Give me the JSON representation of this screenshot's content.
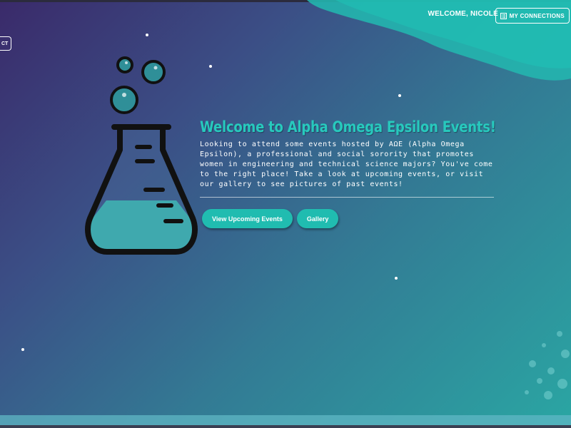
{
  "header": {
    "welcome_text": "WELCOME, NICOLE",
    "connections_label": "MY CONNECTIONS",
    "connections_icon": "list-icon"
  },
  "side_tab": {
    "label": "CT"
  },
  "hero": {
    "title": "Welcome to Alpha Omega Epsilon Events!",
    "description": "Looking to attend some events hosted by ΑΩΕ (Alpha Omega Epsilon), a professional and social sorority that promotes women in engineering and technical science majors? You've come to the right place! Take a look at upcoming events, or visit our gallery to see pictures of past events!",
    "buttons": {
      "upcoming": "View Upcoming Events",
      "gallery": "Gallery"
    }
  },
  "illustration": {
    "icon": "science-flask-icon"
  },
  "colors": {
    "accent": "#20bcb0",
    "title": "#27c9bd",
    "background_start": "#3a2a6a",
    "background_end": "#2aa6a3"
  }
}
